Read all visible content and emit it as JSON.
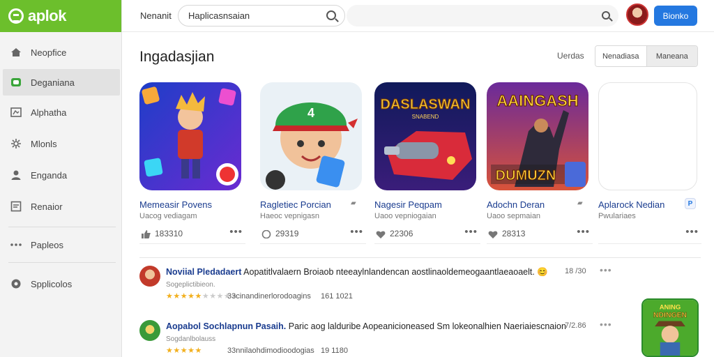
{
  "brand": {
    "logo_text": "aplok",
    "accent": "#6cbf2c"
  },
  "sidebar": {
    "items": [
      {
        "label": "Neopfice",
        "icon": "home-icon"
      },
      {
        "label": "Deganiana",
        "icon": "games-icon",
        "active": true
      },
      {
        "label": "Alphatha",
        "icon": "apps-icon"
      },
      {
        "label": "Mlonls",
        "icon": "puzzle-icon"
      },
      {
        "label": "Enganda",
        "icon": "person-icon"
      },
      {
        "label": "Renaior",
        "icon": "list-icon"
      },
      {
        "label": "Papleos",
        "icon": "dots-icon"
      },
      {
        "label": "Spplicolos",
        "icon": "settings-icon"
      }
    ]
  },
  "header": {
    "label": "Nenanit",
    "search_value": "Haplicasnsaian",
    "signin_label": "Bionko",
    "button_color": "#2478e0"
  },
  "main": {
    "section_title": "Ingadasjian",
    "filter_label": "Uerdas",
    "segments": [
      "Nenadiasa",
      "Maneana"
    ]
  },
  "cards": [
    {
      "title": "Memeasir Povens",
      "subtitle": "Uacog vediagam",
      "count": "183310"
    },
    {
      "title": "Ragletiec Porcian",
      "subtitle": "Haeoc vepnigasn",
      "count": "29319"
    },
    {
      "title": "Nagesir Peqpam",
      "subtitle": "Uaoo vepniogaian",
      "count": "22306"
    },
    {
      "title": "Adochn Deran",
      "subtitle": "Uaoo sepmaian",
      "count": "28313"
    },
    {
      "title": "Aplarock Nedian",
      "subtitle": "Pwulariaes",
      "count": ""
    }
  ],
  "card_art": {
    "card2_text": "4",
    "card3_text": "DASLASWAN",
    "card3_subtext": "SNABEND",
    "card4_text": "AAINGASH",
    "card4_subtext": "DUMUZN"
  },
  "reviews": [
    {
      "name": "Noviial Pledadaert",
      "text": "Aopatitlvalaern Broiaob nteeaylnlandencan aostlinaoldemeogaantlaeaoaelt. 😊",
      "sub": "Sogeplictibieon.",
      "rating": 4.5,
      "meta": "33cinandinerlorodoagins",
      "date": "161 1021",
      "count": "18 /30"
    },
    {
      "name": "Aopabol Sochlapnun Pasaih.",
      "text": "Paric aog lalduribe Aopeanicioneased Sm lokeonalhien Naeriaiescnaion",
      "sub": "Sogdanlbolauss",
      "rating": 4.5,
      "meta": "33nnilaohdimodioodogias",
      "date": "19 1180",
      "count": "7/2.86"
    }
  ],
  "promo_art": {
    "line1": "ANING",
    "line2": "NDINGEN"
  }
}
